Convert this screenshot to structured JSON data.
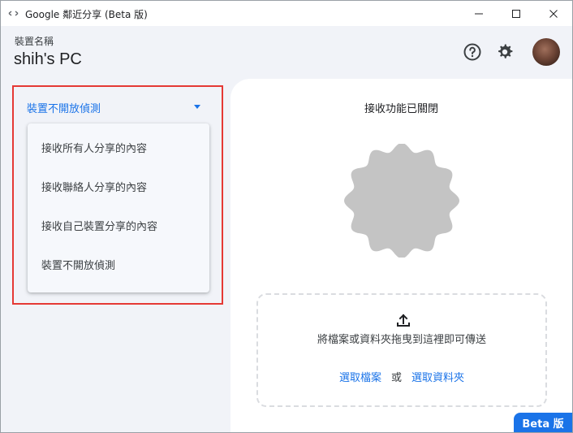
{
  "window": {
    "title": "Google 鄰近分享 (Beta 版)",
    "minimize_glyph": "—",
    "maximize_glyph": "☐",
    "close_glyph": "✕"
  },
  "header": {
    "device_label": "裝置名稱",
    "device_name": "shih's PC",
    "help_icon": "help-circle-icon",
    "settings_icon": "gear-icon"
  },
  "visibility": {
    "selected": "裝置不開放偵測",
    "options": [
      "接收所有人分享的內容",
      "接收聯絡人分享的內容",
      "接收自己裝置分享的內容",
      "裝置不開放偵測"
    ]
  },
  "main": {
    "receive_status": "接收功能已關閉",
    "drop_hint": "將檔案或資料夾拖曳到這裡即可傳送",
    "select_files": "選取檔案",
    "or": "或",
    "select_folder": "選取資料夾"
  },
  "badge": "Beta 版",
  "colors": {
    "accent": "#1a73e8",
    "background": "#f1f3f8",
    "highlight": "#e53935",
    "scallop": "#c4c4c4"
  }
}
